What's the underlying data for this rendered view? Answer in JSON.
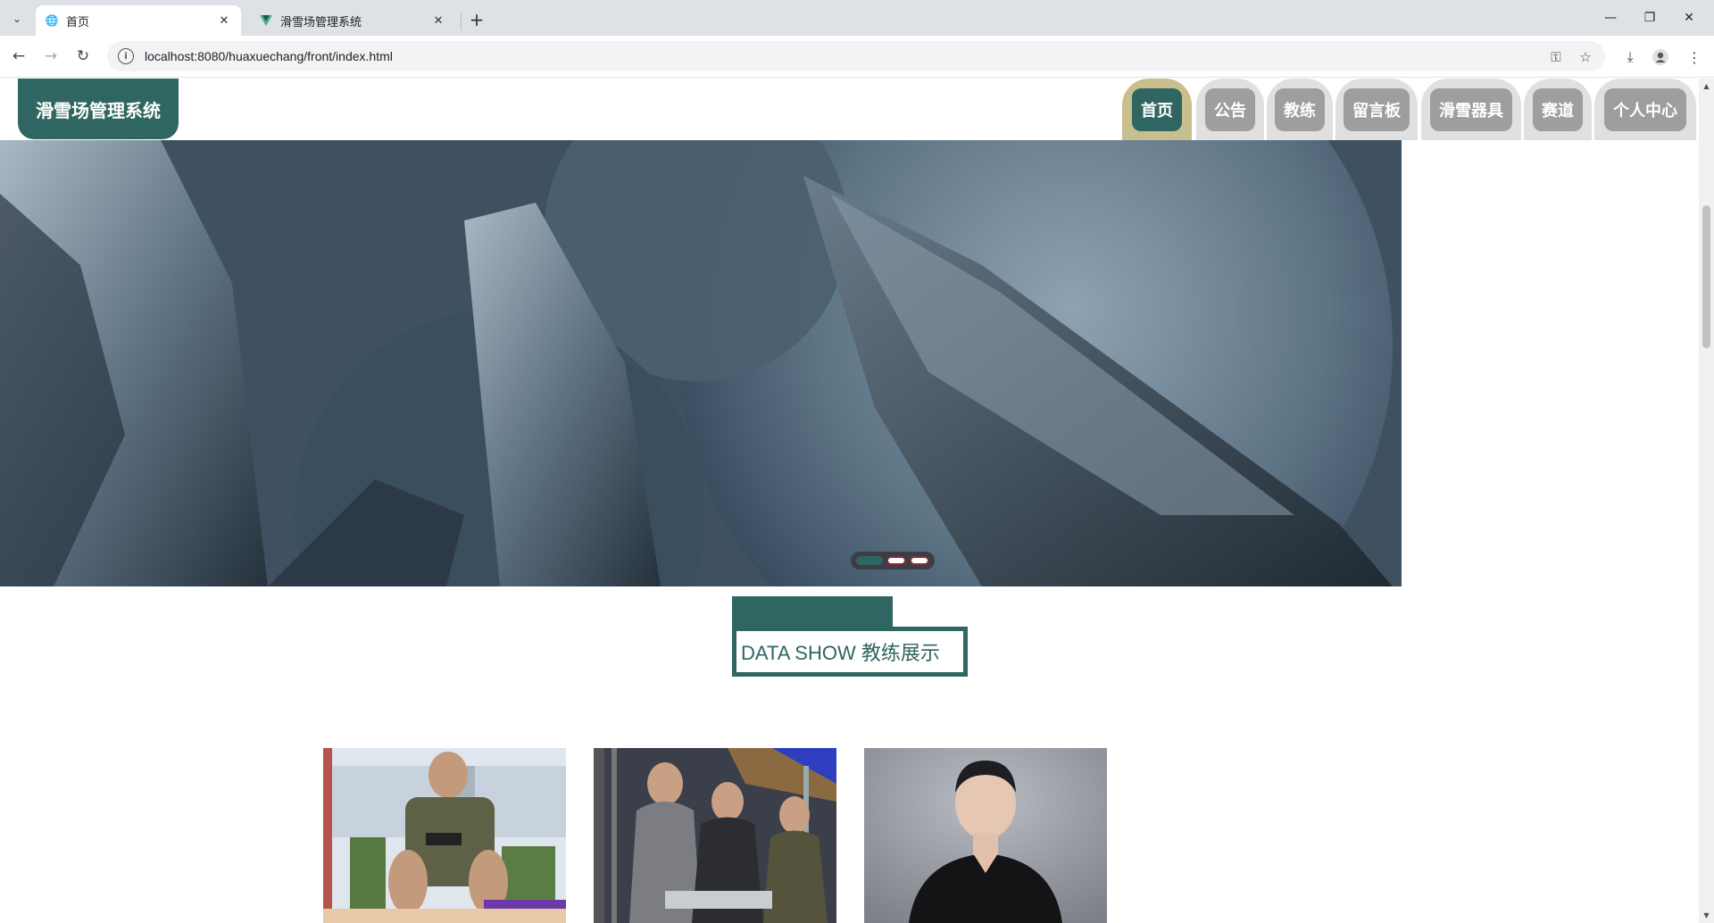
{
  "browser": {
    "tabs": [
      {
        "title": "首页",
        "active": true
      },
      {
        "title": "滑雪场管理系统",
        "active": false
      }
    ],
    "url": "localhost:8080/huaxuechang/front/index.html"
  },
  "site": {
    "logo": "滑雪场管理系统",
    "nav": [
      {
        "label": "首页",
        "active": true
      },
      {
        "label": "公告",
        "active": false
      },
      {
        "label": "教练",
        "active": false
      },
      {
        "label": "留言板",
        "active": false
      },
      {
        "label": "滑雪器具",
        "active": false
      },
      {
        "label": "赛道",
        "active": false
      },
      {
        "label": "个人中心",
        "active": false
      }
    ],
    "carousel": {
      "slides": 3,
      "current_slide": 1
    },
    "section_title": "DATA SHOW 教练展示",
    "coach_cards": [
      {
        "image": "coach-photo-gym-vest"
      },
      {
        "image": "coach-photo-group-training"
      },
      {
        "image": "coach-photo-portrait"
      }
    ]
  },
  "colors": {
    "accent": "#2f6661",
    "nav_active_outer": "#c9be8e",
    "nav_inactive_pill": "#9e9e9e",
    "nav_inactive_outer": "#e0e0e0"
  }
}
